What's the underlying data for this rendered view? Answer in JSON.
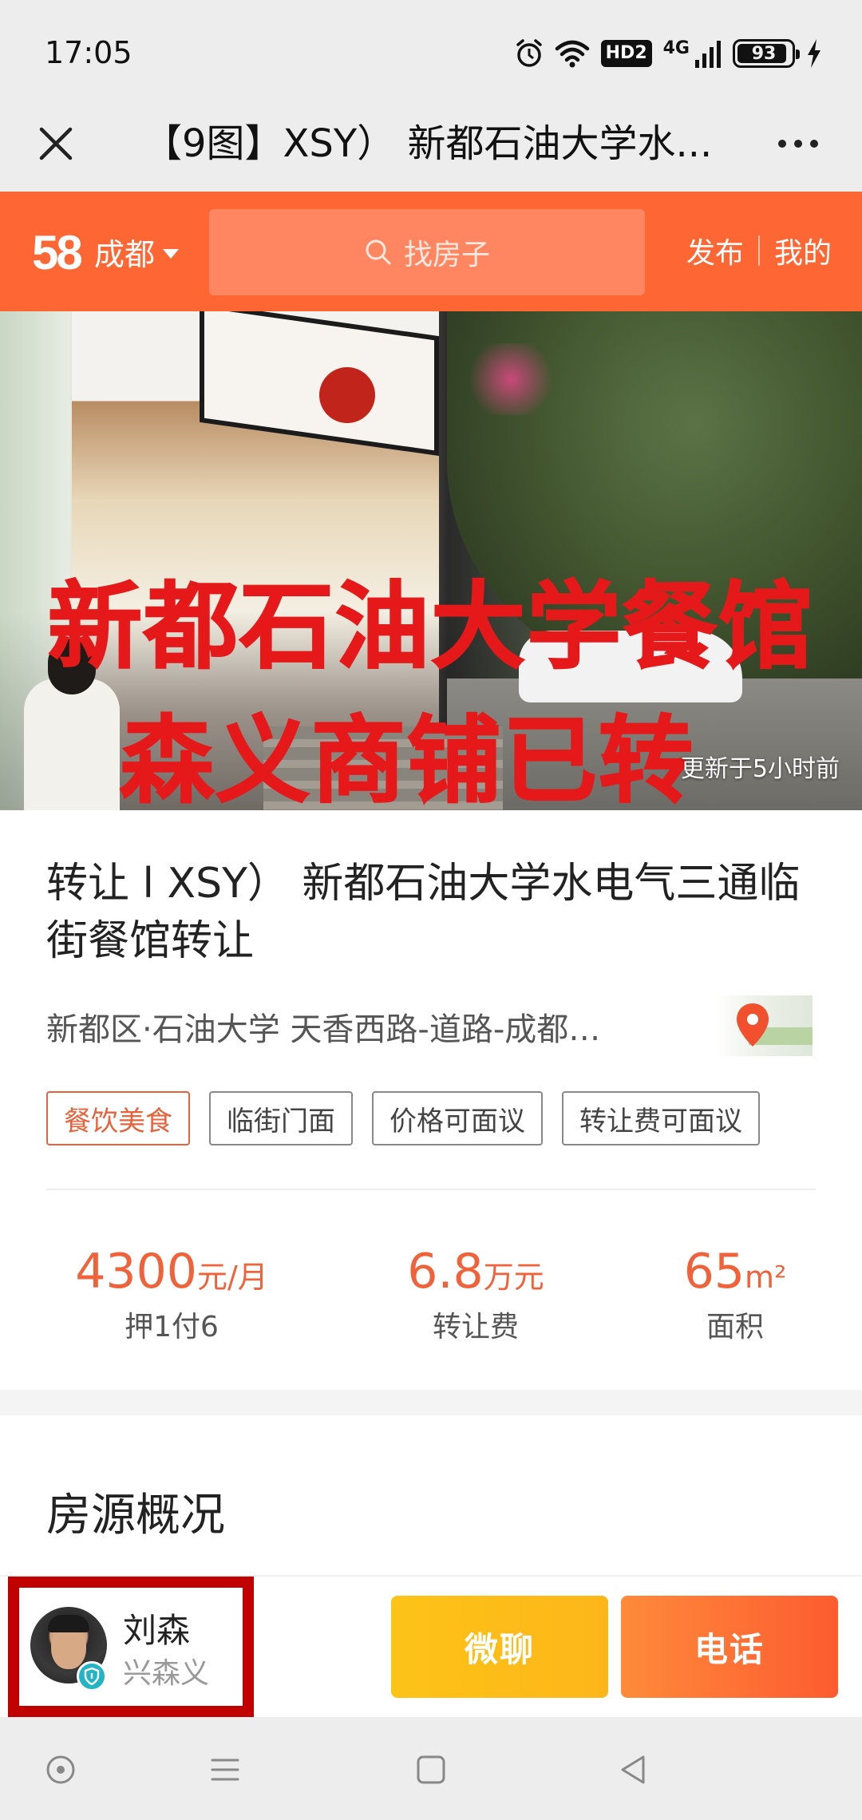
{
  "status_bar": {
    "time": "17:05",
    "hd_label": "HD2",
    "network_label": "4G",
    "battery_level": "93",
    "battery_fraction": 0.93,
    "icons": [
      "alarm-icon",
      "wifi-icon",
      "hd-icon",
      "signal-icon",
      "battery-icon",
      "charging-icon"
    ]
  },
  "title_bar": {
    "title": "【9图】XSY） 新都石油大学水...",
    "close_icon": "close-icon",
    "more_icon": "more-icon"
  },
  "site_header": {
    "logo": "58",
    "city": "成都",
    "search_placeholder": "找房子",
    "publish_label": "发布",
    "mine_label": "我的",
    "brand_color": "#fe6634"
  },
  "hero": {
    "overlay_line1": "新都石油大学餐馆",
    "overlay_line2": "森义商铺已转",
    "update_time": "更新于5小时前",
    "overlay_color": "#e6191a"
  },
  "listing": {
    "title": "转让 l XSY） 新都石油大学水电气三通临街餐馆转让",
    "address": "新都区·石油大学 天香西路-道路-成都…",
    "tags": [
      "餐饮美食",
      "临街门面",
      "价格可面议",
      "转让费可面议"
    ],
    "stats": [
      {
        "value": "4300",
        "unit": "元/月",
        "label": "押1付6"
      },
      {
        "value": "6.8",
        "unit": "万元",
        "label": "转让费"
      },
      {
        "value": "65",
        "unit": "m²",
        "label": "面积"
      }
    ],
    "accent_color": "#f0633a"
  },
  "overview": {
    "title": "房源概况"
  },
  "contact_bar": {
    "agent_name": "刘森",
    "agent_company": "兴森义",
    "chat_label": "微聊",
    "call_label": "电话"
  },
  "nav_bar": {
    "icons": [
      "assistant-icon",
      "menu-icon",
      "home-icon",
      "back-icon"
    ]
  }
}
